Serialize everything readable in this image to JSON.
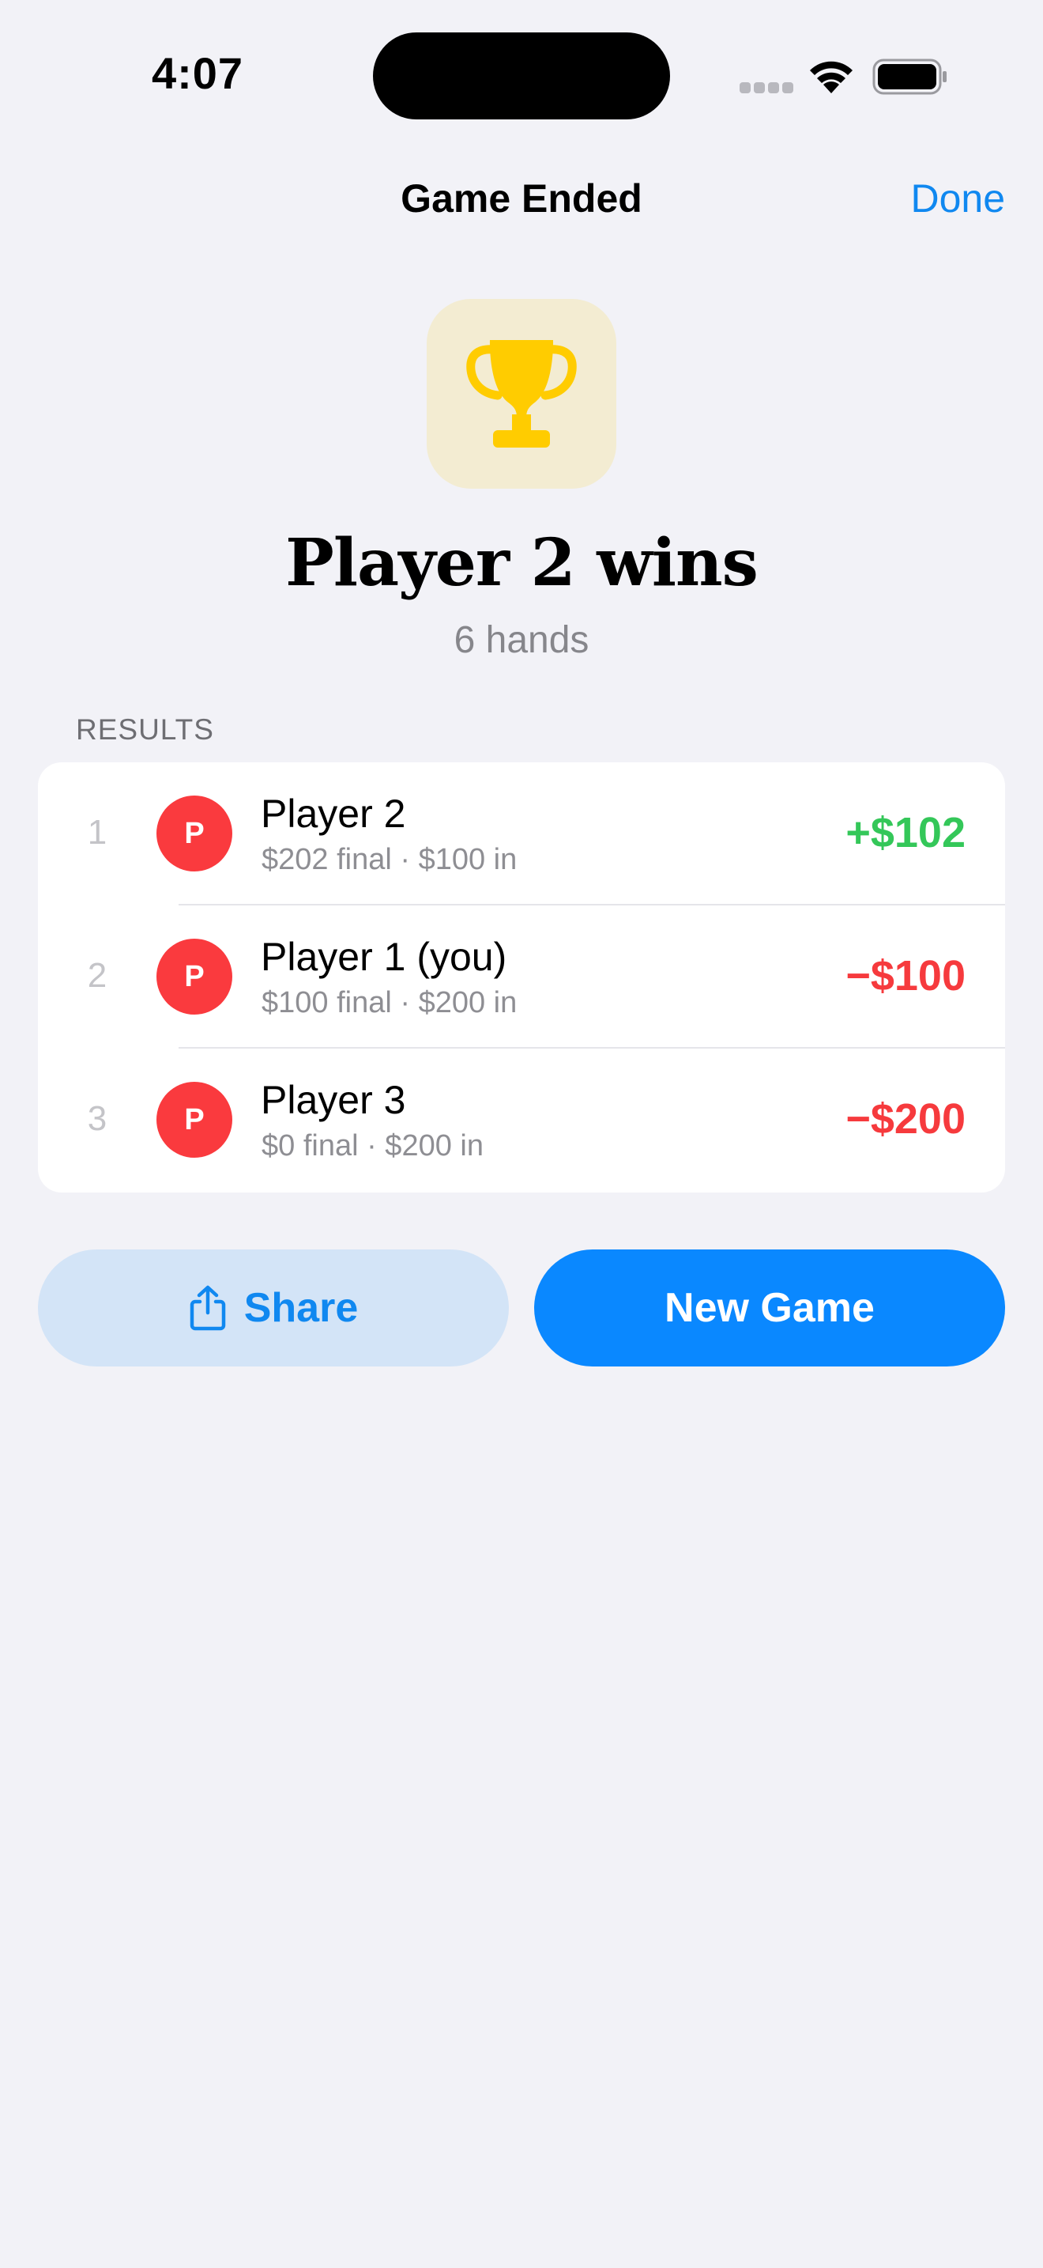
{
  "status_bar": {
    "time": "4:07"
  },
  "nav": {
    "title": "Game Ended",
    "done_label": "Done"
  },
  "hero": {
    "icon": "trophy-icon",
    "title": "Player 2 wins",
    "subtitle": "6 hands"
  },
  "results": {
    "header": "RESULTS",
    "rows": [
      {
        "rank": "1",
        "avatar": "P",
        "name": "Player 2",
        "detail": "$202 final · $100 in",
        "delta": "+$102",
        "status": "positive"
      },
      {
        "rank": "2",
        "avatar": "P",
        "name": "Player 1 (you)",
        "detail": "$100 final · $200 in",
        "delta": "−$100",
        "status": "negative"
      },
      {
        "rank": "3",
        "avatar": "P",
        "name": "Player 3",
        "detail": "$0 final · $200 in",
        "delta": "−$200",
        "status": "negative"
      }
    ]
  },
  "actions": {
    "share_label": "Share",
    "share_icon": "share-icon",
    "new_game_label": "New Game"
  },
  "colors": {
    "background": "#F2F2F7",
    "accent": "#0A88FF",
    "positive": "#34C759",
    "negative": "#F63A3D",
    "avatar": "#FA3A3E",
    "trophy": "#FFCC00",
    "trophy_tile": "#F3ECD2"
  }
}
